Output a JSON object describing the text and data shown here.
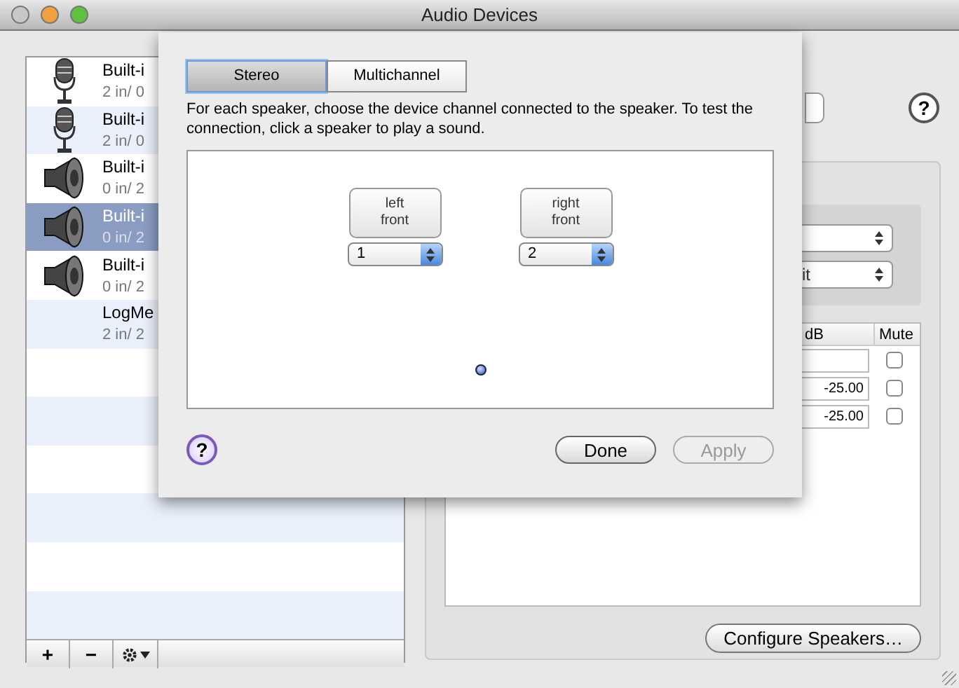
{
  "window": {
    "title": "Audio Devices"
  },
  "devices": [
    {
      "kind": "mic",
      "name": "Built-i",
      "io": "2 in/ 0",
      "selected": false
    },
    {
      "kind": "mic",
      "name": "Built-i",
      "io": "2 in/ 0",
      "selected": false
    },
    {
      "kind": "speaker",
      "name": "Built-i",
      "io": "0 in/ 2",
      "selected": false
    },
    {
      "kind": "speaker",
      "name": "Built-i",
      "io": "0 in/ 2",
      "selected": true
    },
    {
      "kind": "speaker",
      "name": "Built-i",
      "io": "0 in/ 2",
      "selected": false
    },
    {
      "kind": "none",
      "name": "LogMe",
      "io": "2 in/ 2",
      "selected": false
    }
  ],
  "list_toolbar": [
    "+",
    "−"
  ],
  "sheet": {
    "tabs": [
      {
        "label": "Stereo",
        "selected": true
      },
      {
        "label": "Multichannel",
        "selected": false
      }
    ],
    "instructions": "For each speaker, choose the device channel connected to the speaker. To test the connection, click a speaker to play a sound.",
    "speakers": [
      {
        "label": "left front",
        "channel": "1"
      },
      {
        "label": "right front",
        "channel": "2"
      }
    ],
    "help": "?",
    "buttons": [
      {
        "label": "Done",
        "disabled": false
      },
      {
        "label": "Apply",
        "disabled": true
      }
    ]
  },
  "right_panel": {
    "help": "?",
    "format_text": "it",
    "columns": [
      "dB",
      "Mute"
    ],
    "rows": [
      {
        "value": "",
        "muted": false
      },
      {
        "value": "-25.00",
        "muted": false
      },
      {
        "value": "-25.00",
        "muted": false
      }
    ],
    "configure_button": "Configure Speakers…"
  }
}
